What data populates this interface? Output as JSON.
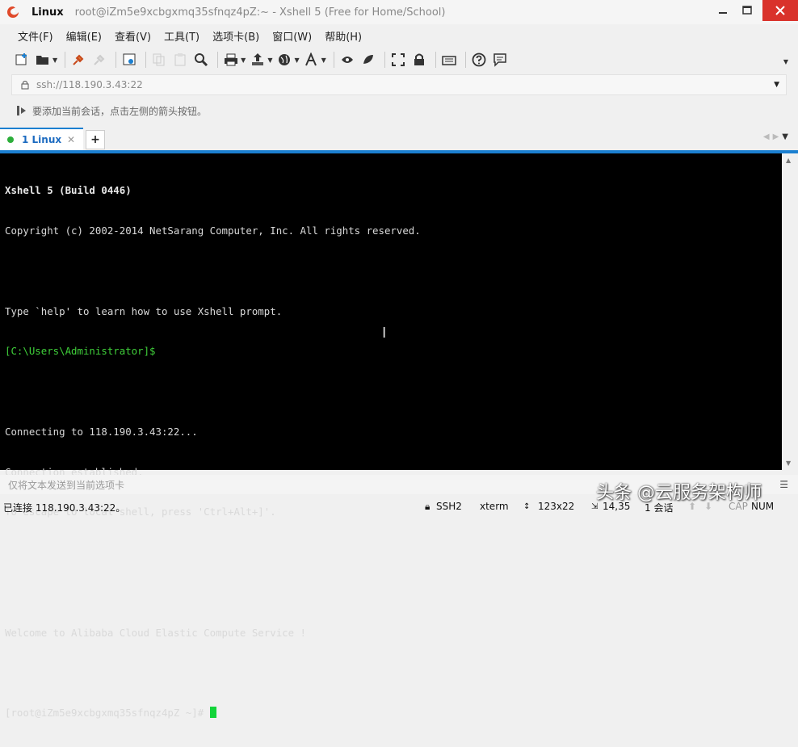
{
  "window": {
    "app_name": "Linux",
    "full_title": "root@iZm5e9xcbgxmq35sfnqz4pZ:~ - Xshell 5 (Free for Home/School)"
  },
  "menu": [
    "文件(F)",
    "编辑(E)",
    "查看(V)",
    "工具(T)",
    "选项卡(B)",
    "窗口(W)",
    "帮助(H)"
  ],
  "address": {
    "value": "ssh://118.190.3.43:22"
  },
  "hint": "要添加当前会话，点击左侧的箭头按钮。",
  "tabs": [
    {
      "label": "1 Linux",
      "status_color": "#2cae3a"
    }
  ],
  "terminal": {
    "lines": [
      "Xshell 5 (Build 0446)",
      "Copyright (c) 2002-2014 NetSarang Computer, Inc. All rights reserved.",
      "",
      "Type `help' to learn how to use Xshell prompt.",
      "[C:\\Users\\Administrator]$",
      "",
      "Connecting to 118.190.3.43:22...",
      "Connection established.",
      "To escape to local shell, press 'Ctrl+Alt+]'.",
      "",
      "",
      "Welcome to Alibaba Cloud Elastic Compute Service !",
      "",
      "[root@iZm5e9xcbgxmq35sfnqz4pZ ~]# "
    ],
    "prompt_color": "#3fcf3a",
    "cursor_color": "#13d43a"
  },
  "sendbar": {
    "placeholder": "仅将文本发送到当前选项卡"
  },
  "status": {
    "connected": "已连接 118.190.3.43:22。",
    "protocol": "SSH2",
    "terminal_type": "xterm",
    "size": "123x22",
    "position": "14,35",
    "sessions": "1 会话",
    "caps": "CAP",
    "num": "NUM"
  },
  "watermark": "头条 @云服务架构师",
  "colors": {
    "accent": "#1b7fd0",
    "close": "#d9322b",
    "terminal_bg": "#000000"
  }
}
